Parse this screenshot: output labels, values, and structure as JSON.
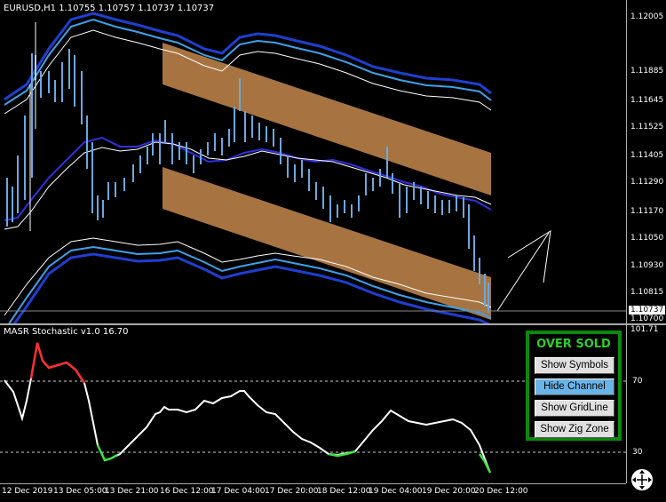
{
  "chart": {
    "symbol_title": "EURUSD,H1  1.10755 1.10757 1.10737 1.10737",
    "price_axis": [
      "1.12005",
      "1.11885",
      "1.11645",
      "1.11525",
      "1.11405",
      "1.11290",
      "1.11170",
      "1.11050",
      "1.10930",
      "1.10815"
    ],
    "price_axis_bottom": "1.10700",
    "current_price": "1.10737"
  },
  "indicator": {
    "title": "MASR Stochastic v1.0 16.70",
    "axis": {
      "top": "101.71",
      "upper": "70",
      "lower": "30"
    }
  },
  "time_axis": [
    "12 Dec 2019",
    "13 Dec 05:00",
    "13 Dec 21:00",
    "16 Dec 12:00",
    "17 Dec 04:00",
    "17 Dec 20:00",
    "18 Dec 12:00",
    "19 Dec 04:00",
    "19 Dec 20:00",
    "20 Dec 12:00"
  ],
  "panel": {
    "status": "OVER SOLD",
    "buttons": [
      "Show Symbols",
      "Hide Channel",
      "Show GridLine",
      "Show Zig Zone"
    ]
  },
  "colors": {
    "channel": "#b07a45",
    "candles": "#6aa8e0",
    "band_blue": "#1e4fd8",
    "band_light": "#3ea0e8",
    "overbought": "#ff3030",
    "oversold": "#40e040",
    "panel_border": "#0a8a0a"
  },
  "icons": {
    "zoom": "zoom-icon"
  }
}
